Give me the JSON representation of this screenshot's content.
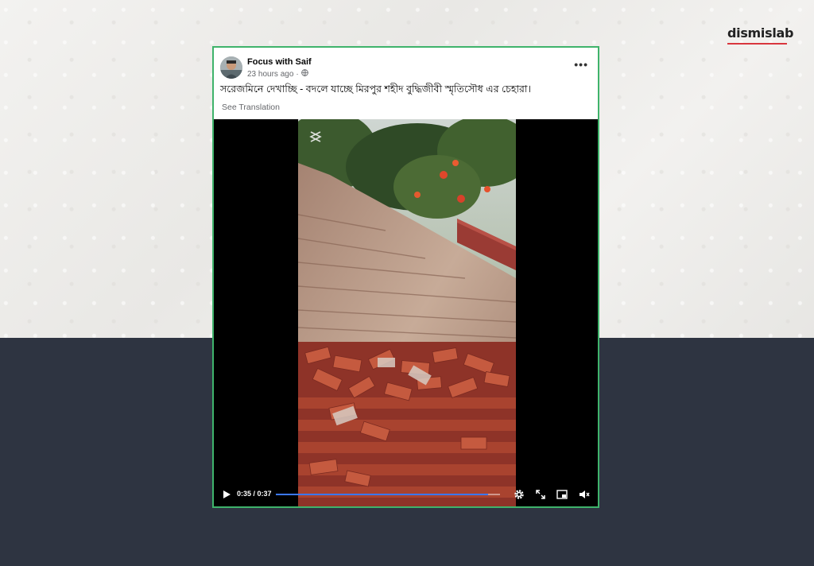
{
  "brand": {
    "logo_text": "dismislab",
    "accent_color": "#d9363e"
  },
  "post": {
    "author": "Focus with Saif",
    "time": "23 hours ago",
    "privacy_icon": "globe-icon",
    "more_icon": "more-options-icon",
    "more_label": "•••",
    "caption": "সরেজমিনে দেখাচ্ছি - বদলে যাচ্ছে মিরপুর শহীদ বুদ্ধিজীবী স্মৃতিসৌধ এর চেহারা।",
    "see_translation": "See Translation",
    "border_color": "#3fb36b"
  },
  "video": {
    "current_time": "0:35",
    "duration": "0:37",
    "time_display": "0:35 / 0:37",
    "progress": 0.946,
    "controls": [
      "play-icon",
      "settings-gear-icon",
      "fullscreen-icon",
      "picture-in-picture-icon",
      "mute-icon"
    ]
  }
}
